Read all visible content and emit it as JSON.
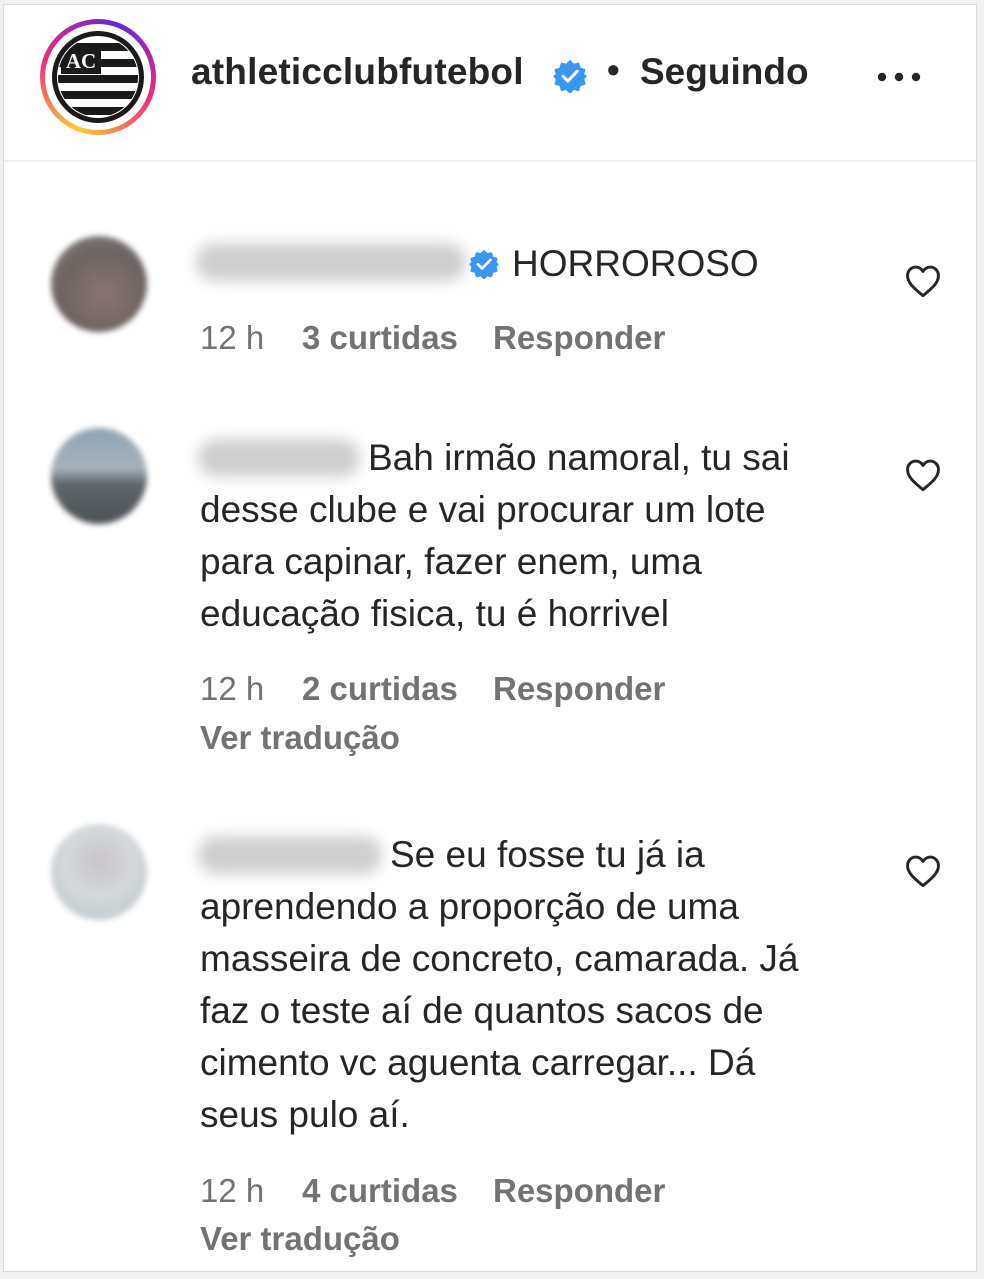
{
  "header": {
    "username": "athleticclubfutebol",
    "separator": "•",
    "follow_status": "Seguindo",
    "logo_letters": "AC"
  },
  "colors": {
    "verified": "#3897f0",
    "meta_text": "#737373",
    "primary_text": "#262626"
  },
  "comments": [
    {
      "text_line1": "HORROROSO",
      "text_rest": "",
      "time": "12 h",
      "likes": "3 curtidas",
      "reply": "Responder",
      "translate": "",
      "verified": true
    },
    {
      "text_line1": "Bah irmão namoral, tu sai",
      "text_rest": "desse clube e vai procurar um lote\npara capinar, fazer enem, uma\neducação fisica, tu é horrivel",
      "time": "12 h",
      "likes": "2 curtidas",
      "reply": "Responder",
      "translate": "Ver tradução",
      "verified": false
    },
    {
      "text_line1": "Se eu fosse tu já ia",
      "text_rest": "aprendendo a proporção de uma\nmasseira de concreto, camarada. Já\nfaz o teste aí de quantos sacos de\ncimento vc aguenta carregar... Dá\nseus pulo aí.",
      "time": "12 h",
      "likes": "4 curtidas",
      "reply": "Responder",
      "translate": "Ver tradução",
      "verified": false
    }
  ]
}
